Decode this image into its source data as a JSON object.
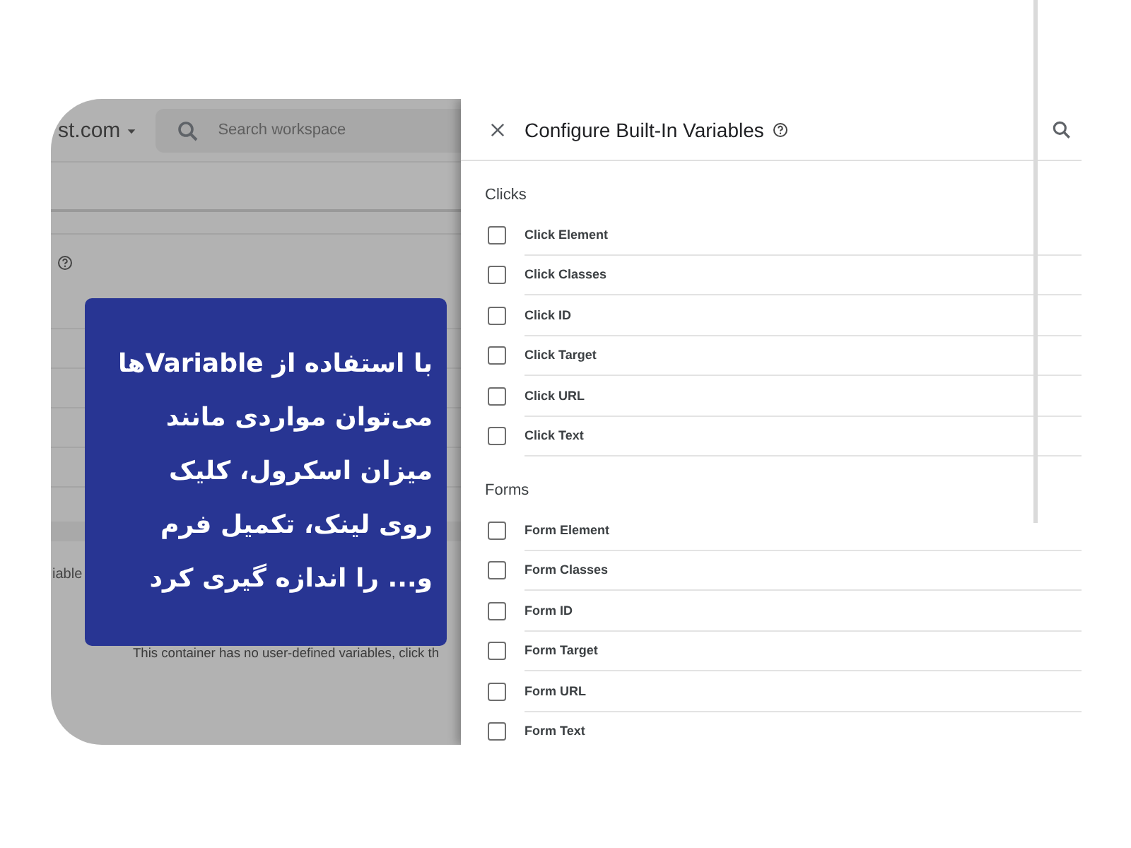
{
  "background_page": {
    "account": "st.com",
    "search": {
      "placeholder": "Search workspace"
    },
    "partial_label": "iable",
    "empty_message": "This container has no user-defined variables, click th"
  },
  "callout": {
    "lines": [
      "با استفاده از Variableها",
      "می‌توان مواردی مانند",
      "میزان اسکرول، کلیک",
      "روی لینک، تکمیل فرم",
      "و... را اندازه گیری کرد"
    ]
  },
  "panel": {
    "title": "Configure Built-In Variables",
    "sections": [
      {
        "heading": "Clicks",
        "items": [
          {
            "label": "Click Element",
            "checked": false
          },
          {
            "label": "Click Classes",
            "checked": false
          },
          {
            "label": "Click ID",
            "checked": false
          },
          {
            "label": "Click Target",
            "checked": false
          },
          {
            "label": "Click URL",
            "checked": false
          },
          {
            "label": "Click Text",
            "checked": false
          }
        ]
      },
      {
        "heading": "Forms",
        "items": [
          {
            "label": "Form Element",
            "checked": false
          },
          {
            "label": "Form Classes",
            "checked": false
          },
          {
            "label": "Form ID",
            "checked": false
          },
          {
            "label": "Form Target",
            "checked": false
          },
          {
            "label": "Form URL",
            "checked": false
          },
          {
            "label": "Form Text",
            "checked": false
          }
        ]
      }
    ]
  }
}
